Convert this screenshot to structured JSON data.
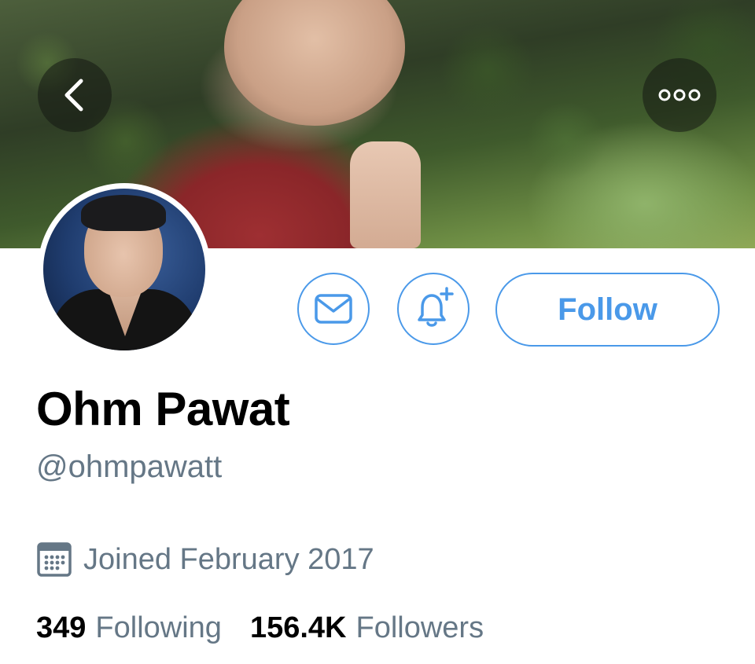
{
  "header": {
    "back_icon": "chevron-left-icon",
    "more_icon": "more-horizontal-icon"
  },
  "actions": {
    "message_icon": "mail-icon",
    "notify_icon": "bell-plus-icon",
    "follow_label": "Follow",
    "accent_color": "#4a99e9"
  },
  "profile": {
    "display_name": "Ohm Pawat",
    "handle": "@ohmpawatt",
    "joined_icon": "calendar-icon",
    "joined": "Joined February 2017"
  },
  "stats": {
    "following_count": "349",
    "following_label": "Following",
    "followers_count": "156.4K",
    "followers_label": "Followers"
  }
}
